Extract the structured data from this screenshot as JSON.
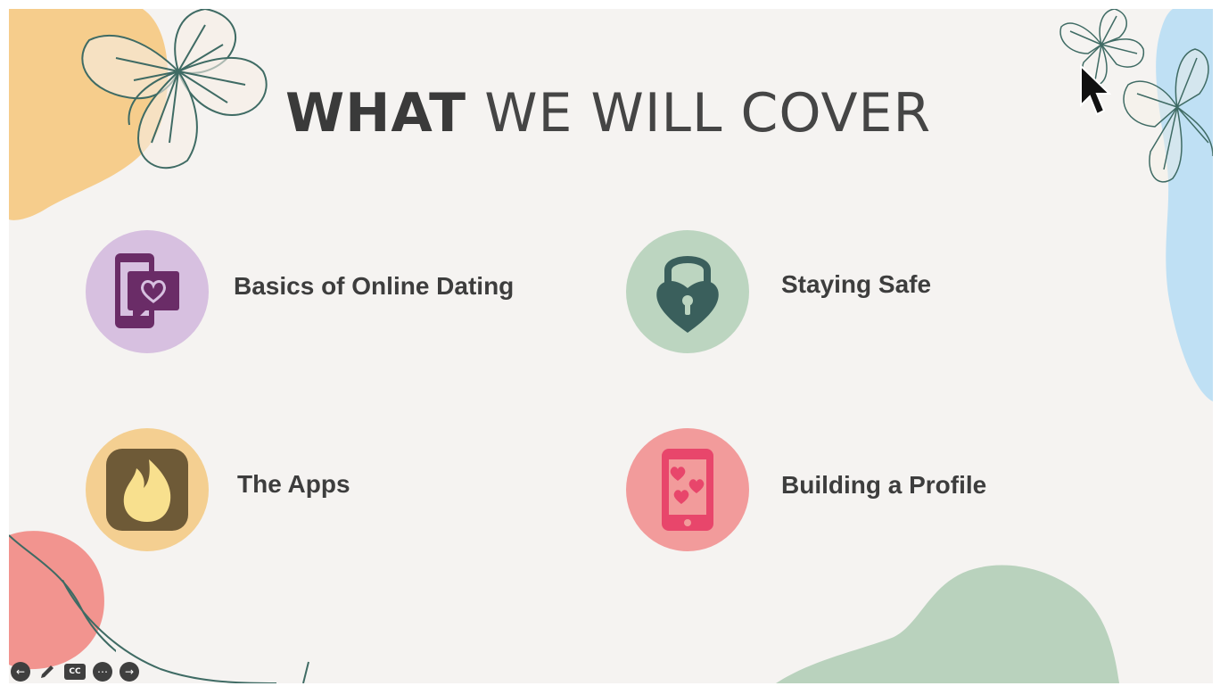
{
  "slide": {
    "title_bold": "WHAT",
    "title_light": "WE WILL COVER"
  },
  "topics": [
    {
      "label": "Basics of Online Dating",
      "icon": "phone-heart-chat-icon",
      "circle_color": "#d7c0e0",
      "icon_color": "#6a2c67"
    },
    {
      "label": "Staying Safe",
      "icon": "heart-padlock-icon",
      "circle_color": "#bcd5c0",
      "icon_color": "#3a5f5c"
    },
    {
      "label": "The Apps",
      "icon": "flame-app-icon",
      "circle_color": "#f4cf91",
      "icon_color": "#6e5a37"
    },
    {
      "label": "Building a Profile",
      "icon": "phone-hearts-icon",
      "circle_color": "#f29b9b",
      "icon_color": "#e8466b"
    }
  ],
  "toolbar": {
    "prev": "←",
    "cc": "CC",
    "more": "⋯",
    "next": "→"
  },
  "colors": {
    "background": "#f5f3f1",
    "orange_blob": "#f6cd8c",
    "blue_blob": "#bfe0f4",
    "green_blob": "#b9d2bd",
    "red_blob": "#f2948f",
    "flower_line": "#3f6b64"
  }
}
